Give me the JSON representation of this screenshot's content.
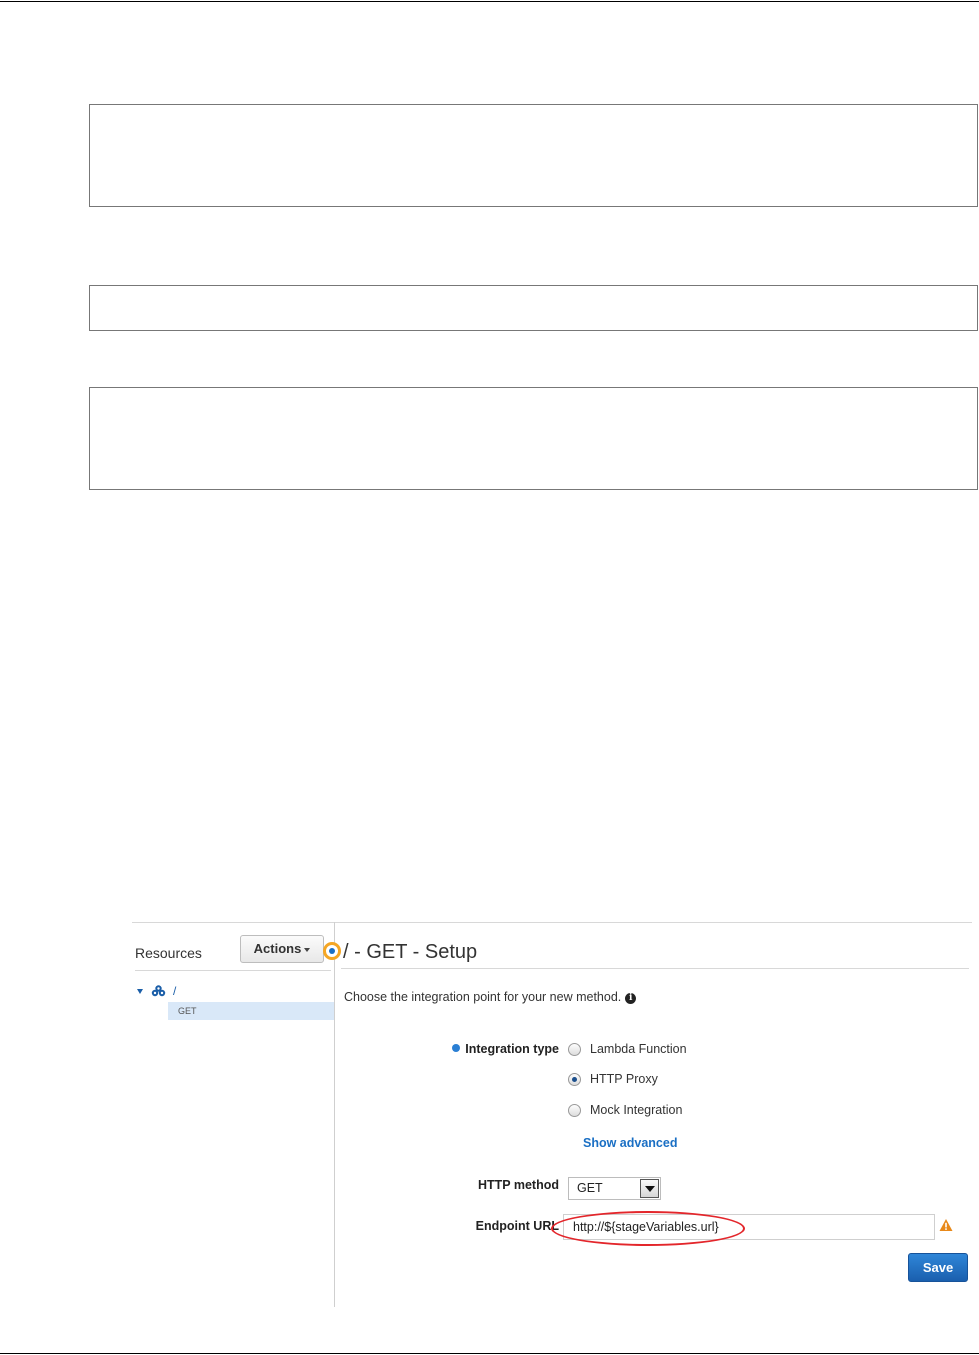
{
  "resources": {
    "title": "Resources",
    "actions_label": "Actions",
    "tree": {
      "root": "/",
      "method": "GET"
    }
  },
  "setup": {
    "title": "/ - GET - Setup",
    "description": "Choose the integration point for your new method.",
    "integration_type_label": "Integration type",
    "options": [
      {
        "label": "Lambda Function",
        "selected": false
      },
      {
        "label": "HTTP Proxy",
        "selected": true
      },
      {
        "label": "Mock Integration",
        "selected": false
      }
    ],
    "show_advanced": "Show advanced",
    "http_method_label": "HTTP method",
    "http_method_value": "GET",
    "endpoint_label": "Endpoint URL",
    "endpoint_value": "http://${stageVariables.url}",
    "save_label": "Save"
  },
  "colors": {
    "accent": "#1a6fc4",
    "highlight_ring": "#e3262b",
    "warning": "#e8891a",
    "selected_row": "#d9e8f8"
  }
}
